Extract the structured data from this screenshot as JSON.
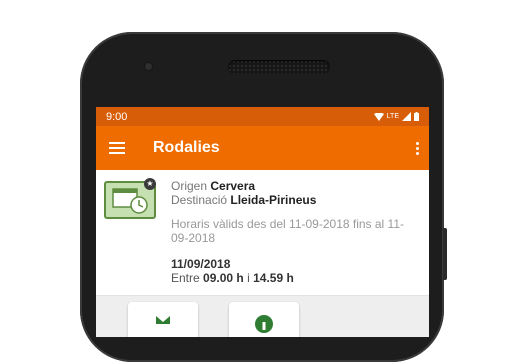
{
  "status_bar": {
    "time": "9:00",
    "network": "LTE"
  },
  "app_bar": {
    "title": "Rodalies"
  },
  "trip": {
    "origin_label": "Origen",
    "origin": "Cervera",
    "destination_label": "Destinació",
    "destination": "Lleida-Pirineus",
    "validity": "Horaris vàlids des del 11-09-2018 fins al 11-09-2018",
    "date": "11/09/2018",
    "time_prefix": "Entre",
    "time_start": "09.00 h",
    "time_joiner": "i",
    "time_end": "14.59 h"
  },
  "colors": {
    "primary": "#ef6c00",
    "status_bar": "#d75d08",
    "icon_green": "#5e8d3f"
  }
}
